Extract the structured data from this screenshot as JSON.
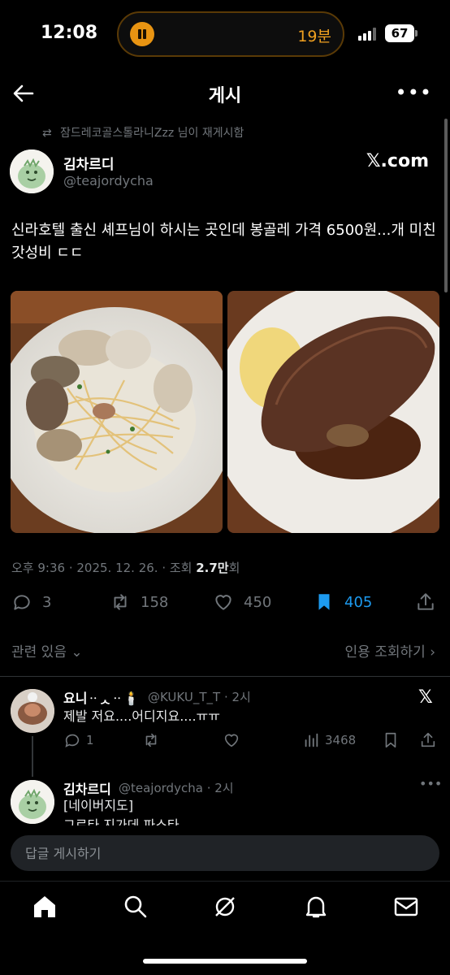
{
  "status": {
    "time": "12:08",
    "timer": "19분",
    "battery": "67"
  },
  "header": {
    "title": "게시"
  },
  "repost": {
    "text": "잠드레코골스톨라니Zzz 님이 재게시함"
  },
  "tweet": {
    "author": "김차르디",
    "handle": "@teajordycha",
    "source": "𝕏.com",
    "text": "신라호텔 출신 셰프님이 하시는 곳인데 봉골레 가격 6500원...개 미친갓성비 ㄷㄷ",
    "meta_prefix": "오후 9:36 · 2025. 12. 26. · 조회 ",
    "views": "2.7만",
    "meta_suffix": "회",
    "stats": {
      "replies": "3",
      "reposts": "158",
      "likes": "450",
      "bookmarks": "405"
    },
    "photos": [
      "vongole-pasta",
      "steak"
    ]
  },
  "related": {
    "label": "관련 있음",
    "quote_label": "인용 조회하기"
  },
  "replies": [
    {
      "name": "요니ᆢᆺᆢ🕯️",
      "handle": "@KUKU_T_T",
      "time": "· 2시",
      "text": "제발 저요....어디지요....ㅠㅠ",
      "stats": {
        "replies": "1",
        "views": "3468"
      }
    },
    {
      "name": "김차르디",
      "handle": "@teajordycha",
      "time": "· 2시",
      "text_line1": "[네이버지도]",
      "text_line2": "그르타 지가데 파스타"
    }
  ],
  "composer": {
    "placeholder": "답글 게시하기"
  },
  "tabs": [
    "home-icon",
    "search-icon",
    "grok-icon",
    "bell-icon",
    "mail-icon"
  ],
  "colors": {
    "accent": "#1d9bf0",
    "background": "#000000",
    "muted": "#71767b",
    "timer": "#f0a020"
  }
}
